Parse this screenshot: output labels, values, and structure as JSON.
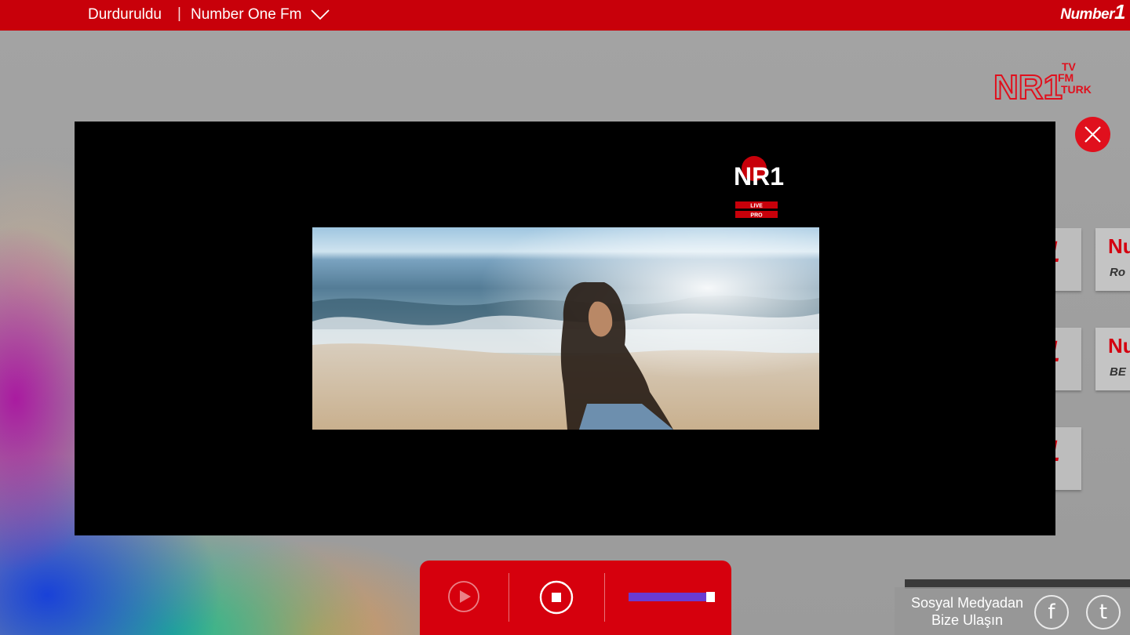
{
  "top_bar": {
    "status": "Durduruldu",
    "separator": "|",
    "station": "Number One Fm",
    "brand_text": "Number",
    "brand_number": "1"
  },
  "corner_logo": {
    "main": "NR1",
    "lines": [
      "TV",
      "FM",
      "TURK"
    ]
  },
  "video": {
    "channel_logo_text": "NR1",
    "channel_logo_sub": [
      "LIVE",
      "PRO"
    ]
  },
  "side_tiles": [
    {
      "t1": "Nu",
      "t2": "Ro"
    },
    {
      "t1": "Nu",
      "t2": "BE"
    }
  ],
  "player": {
    "play_icon": "play-icon",
    "stop_icon": "stop-icon",
    "volume_fraction": 1.0
  },
  "social": {
    "label_line1": "Sosyal Medyadan",
    "label_line2": "Bize Ulaşın",
    "facebook_glyph": "f",
    "twitter_glyph": "t"
  },
  "colors": {
    "brand_red": "#c8000a",
    "volume": "#6a3bd2"
  }
}
